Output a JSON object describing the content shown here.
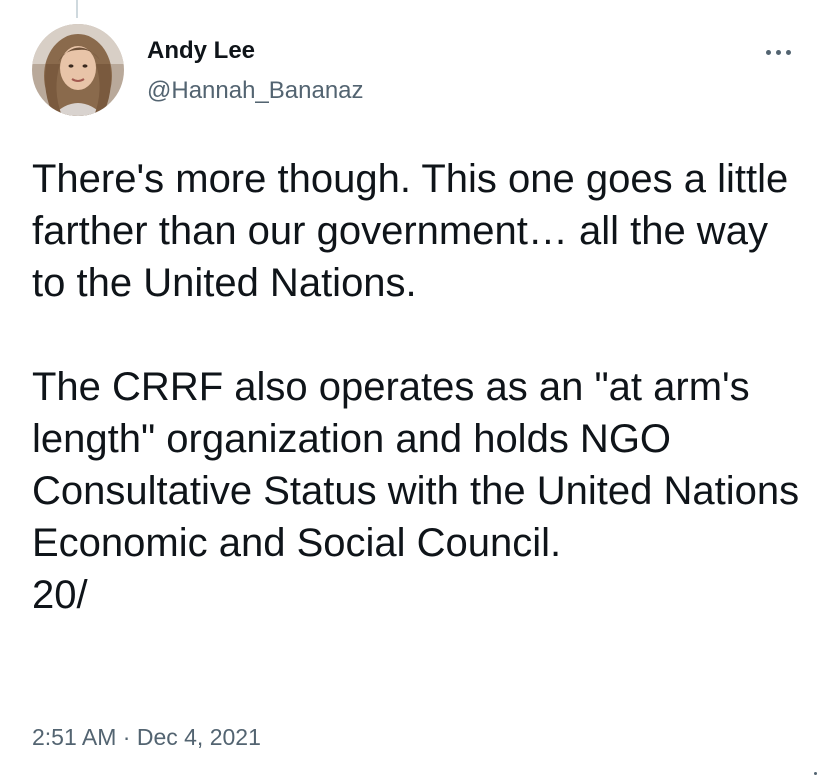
{
  "tweet": {
    "author": {
      "display_name": "Andy Lee",
      "handle": "@Hannah_Bananaz",
      "avatar_icon": "profile-photo"
    },
    "text": "There's more though. This one goes a little farther than our government… all the way to the United Nations.\n\nThe CRRF also operates as an \"at arm's length\" organization and holds NGO Consultative Status with the United Nations Economic and Social Council.\n20/",
    "time": "2:51 AM",
    "separator": "·",
    "date": "Dec 4, 2021"
  },
  "icons": {
    "more": "more-options-icon"
  },
  "colors": {
    "text_primary": "#0f1419",
    "text_secondary": "#536471",
    "thread_line": "#cfd9de",
    "background": "#ffffff"
  }
}
